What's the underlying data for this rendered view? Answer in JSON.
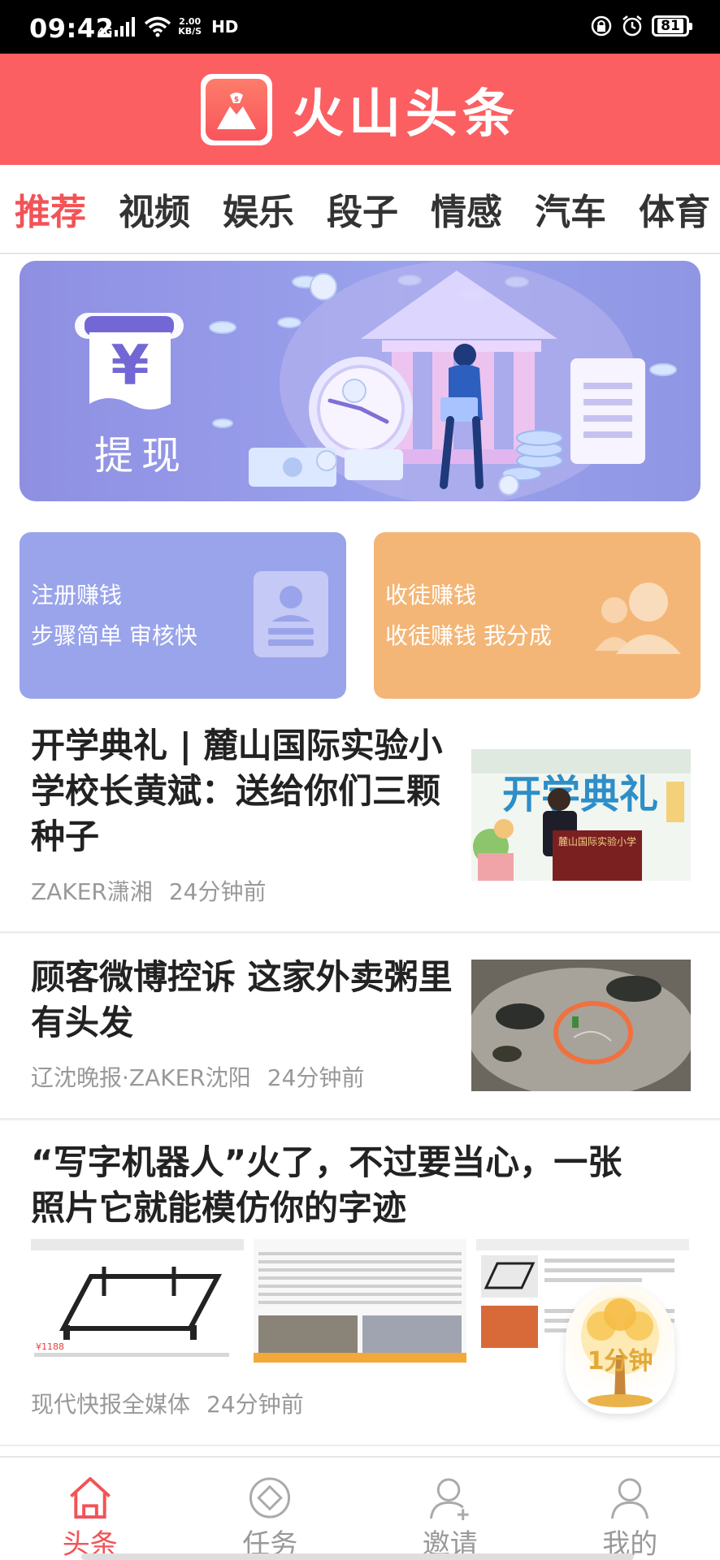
{
  "status_bar": {
    "time": "09:42",
    "network_tag": "4G",
    "speed_value": "2.00",
    "speed_unit": "KB/S",
    "hd_label": "HD",
    "battery_level": "81"
  },
  "header": {
    "app_title": "火山头条",
    "brand_color": "#fb5f62"
  },
  "tabs": [
    {
      "label": "推荐",
      "active": true
    },
    {
      "label": "视频"
    },
    {
      "label": "娱乐"
    },
    {
      "label": "段子"
    },
    {
      "label": "情感"
    },
    {
      "label": "汽车"
    },
    {
      "label": "体育"
    }
  ],
  "banner": {
    "label": "提现"
  },
  "cards": {
    "register": {
      "title": "注册赚钱",
      "subtitle": "步骤简单 审核快"
    },
    "recruit": {
      "title": "收徒赚钱",
      "subtitle": "收徒赚钱 我分成"
    }
  },
  "news": [
    {
      "title_lines": [
        "开学典礼 | 麓山国际实验小",
        "学校长黄斌：送给你们三颗",
        "种子"
      ],
      "source": "ZAKER潇湘",
      "time": "24分钟前"
    },
    {
      "title_lines": [
        "顾客微博控诉 这家外卖粥里",
        "有头发"
      ],
      "source": "辽沈晚报·ZAKER沈阳",
      "time": "24分钟前"
    },
    {
      "title_lines": [
        "“写字机器人”火了，不过要当心，一张",
        "照片它就能模仿你的字迹"
      ],
      "source": "现代快报全媒体",
      "time": "24分钟前"
    }
  ],
  "floating_timer": {
    "label": "1分钟"
  },
  "bottom_nav": [
    {
      "label": "头条",
      "icon": "home-icon",
      "active": true
    },
    {
      "label": "任务",
      "icon": "task-icon"
    },
    {
      "label": "邀请",
      "icon": "invite-icon"
    },
    {
      "label": "我的",
      "icon": "profile-icon"
    }
  ]
}
